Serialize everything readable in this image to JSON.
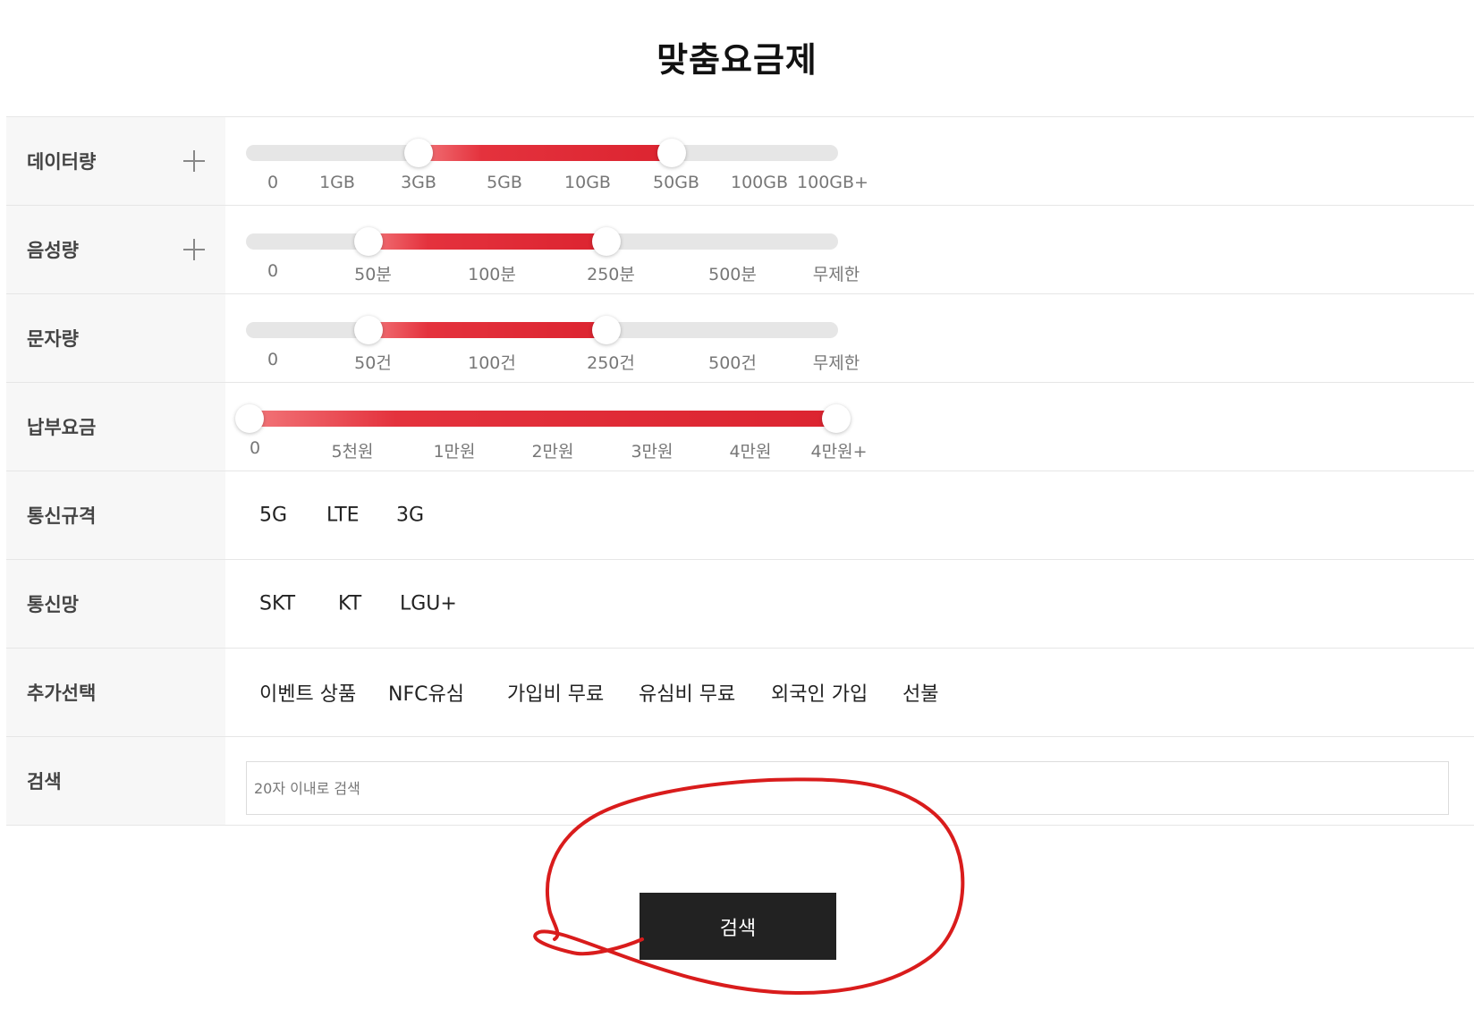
{
  "title": "맞춤요금제",
  "filters": {
    "data": {
      "label": "데이터량",
      "ticks": [
        "0",
        "1GB",
        "3GB",
        "5GB",
        "10GB",
        "50GB",
        "100GB",
        "100GB+"
      ],
      "range": [
        "3GB",
        "50GB"
      ]
    },
    "voice": {
      "label": "음성량",
      "ticks": [
        "0",
        "50분",
        "100분",
        "250분",
        "500분",
        "무제한"
      ],
      "range": [
        "50분",
        "250분"
      ]
    },
    "sms": {
      "label": "문자량",
      "ticks": [
        "0",
        "50건",
        "100건",
        "250건",
        "500건",
        "무제한"
      ],
      "range": [
        "50건",
        "250건"
      ]
    },
    "price": {
      "label": "납부요금",
      "ticks": [
        "0",
        "5천원",
        "1만원",
        "2만원",
        "3만원",
        "4만원",
        "4만원+"
      ],
      "range": [
        "0",
        "4만원+"
      ]
    },
    "network_type": {
      "label": "통신규격",
      "options": [
        "5G",
        "LTE",
        "3G"
      ]
    },
    "carrier": {
      "label": "통신망",
      "options": [
        "SKT",
        "KT",
        "LGU+"
      ]
    },
    "extras": {
      "label": "추가선택",
      "options": [
        "이벤트 상품",
        "NFC유심",
        "가입비 무료",
        "유심비 무료",
        "외국인 가입",
        "선불"
      ]
    },
    "search": {
      "label": "검색",
      "placeholder": "20자 이내로 검색"
    }
  },
  "search_button": {
    "label": "검색"
  },
  "annotation_color": "#d91c1c"
}
